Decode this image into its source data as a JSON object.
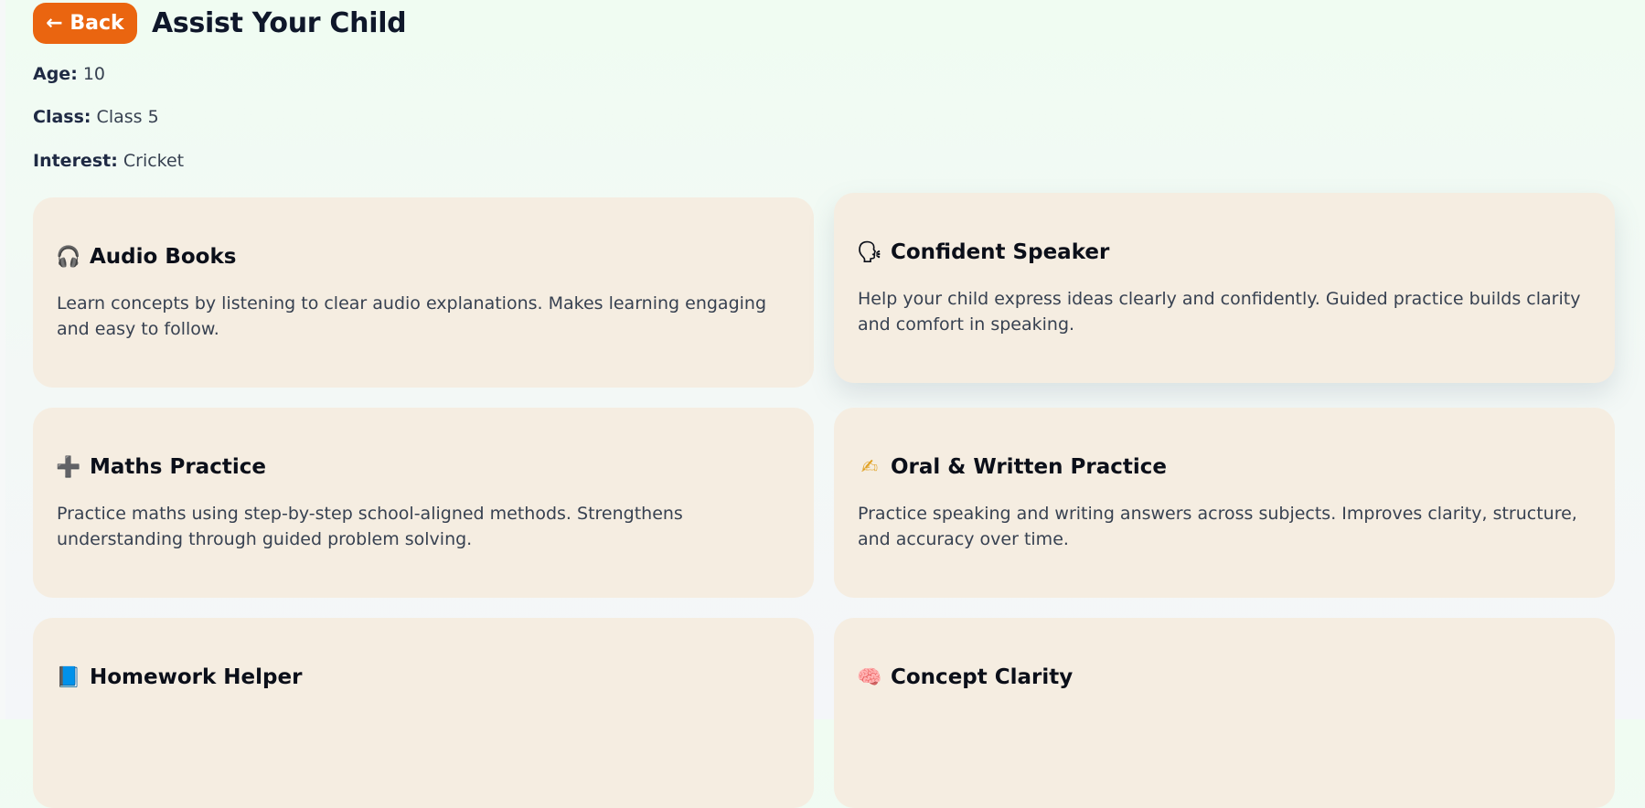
{
  "header": {
    "back_label": "← Back",
    "title": "Assist Your Child"
  },
  "child": {
    "age_label": "Age:",
    "age": "10",
    "class_label": "Class:",
    "class": "Class 5",
    "interest_label": "Interest:",
    "interest": "Cricket"
  },
  "cards": [
    {
      "icon": "🎧",
      "icon_name": "headphones-icon",
      "title": "Audio Books",
      "description": "Learn concepts by listening to clear audio explanations. Makes learning engaging and easy to follow."
    },
    {
      "icon": "🗣",
      "icon_name": "speaking-head-icon",
      "title": "Confident Speaker",
      "description": "Help your child express ideas clearly and confidently. Guided practice builds clarity and comfort in speaking."
    },
    {
      "icon": "➕",
      "icon_name": "plus-icon",
      "title": "Maths Practice",
      "description": "Practice maths using step-by-step school-aligned methods. Strengthens understanding through guided problem solving."
    },
    {
      "icon": "✍",
      "icon_name": "writing-hand-icon",
      "title": "Oral & Written Practice",
      "description": "Practice speaking and writing answers across subjects. Improves clarity, structure, and accuracy over time."
    },
    {
      "icon": "📘",
      "icon_name": "blue-book-icon",
      "title": "Homework Helper",
      "description": ""
    },
    {
      "icon": "🧠",
      "icon_name": "brain-icon",
      "title": "Concept Clarity",
      "description": ""
    }
  ],
  "colors": {
    "accent": "#ea6510",
    "card_bg": "#f5ede1",
    "page_bg_top": "#f0fcf2"
  }
}
